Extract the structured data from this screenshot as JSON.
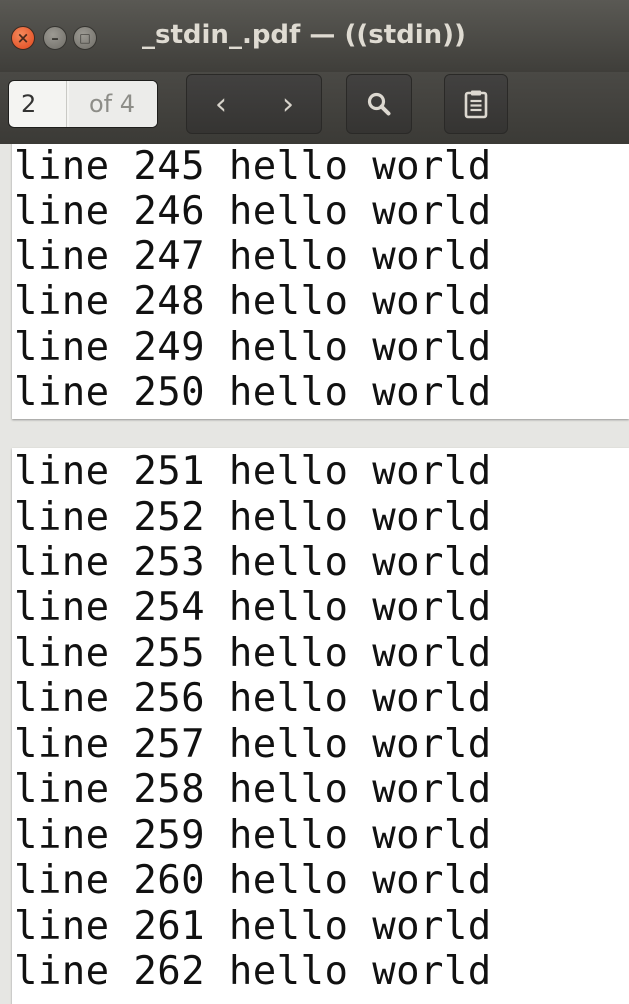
{
  "window": {
    "title": "_stdin_.pdf — ((stdin))",
    "controls": {
      "close": "×",
      "minimize": "–",
      "maximize": "□"
    }
  },
  "toolbar": {
    "page_number": "2",
    "page_total": "of 4",
    "prev_icon": "‹",
    "next_icon": "›",
    "search_icon": "search-icon",
    "menu_icon": "document-menu-icon"
  },
  "pages": [
    {
      "lines": [
        "line 245 hello world",
        "line 246 hello world",
        "line 247 hello world",
        "line 248 hello world",
        "line 249 hello world",
        "line 250 hello world"
      ]
    },
    {
      "lines": [
        "line 251 hello world",
        "line 252 hello world",
        "line 253 hello world",
        "line 254 hello world",
        "line 255 hello world",
        "line 256 hello world",
        "line 257 hello world",
        "line 258 hello world",
        "line 259 hello world",
        "line 260 hello world",
        "line 261 hello world",
        "line 262 hello world"
      ]
    }
  ]
}
